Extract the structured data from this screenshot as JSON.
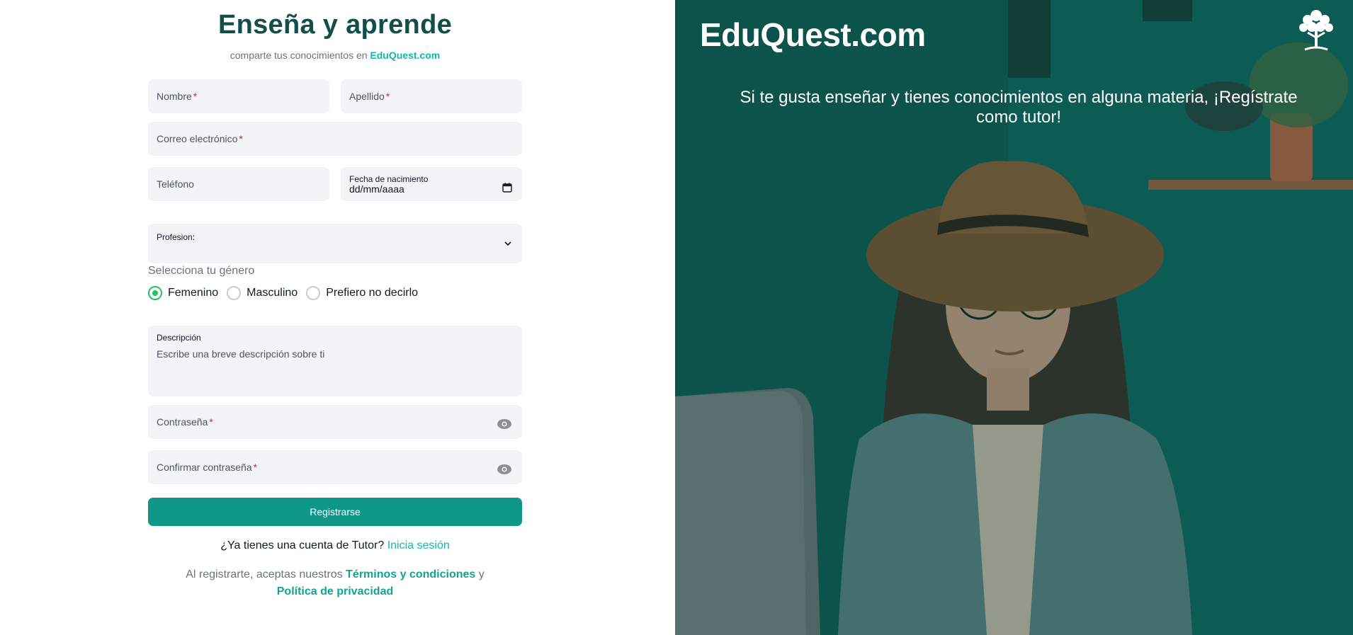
{
  "form": {
    "title": "Enseña y aprende",
    "subtitle_prefix": "comparte tus conocimientos en ",
    "subtitle_brand": "EduQuest.com",
    "required_mark": "*",
    "first_name_label": "Nombre",
    "last_name_label": "Apellido",
    "email_label": "Correo electrónico",
    "phone_label": "Teléfono",
    "birthdate_label": "Fecha de nacimiento",
    "birthdate_value": "dd/mm/aaaa",
    "profession_label": "Profesion:",
    "gender_label": "Selecciona tu género",
    "gender_options": [
      "Femenino",
      "Masculino",
      "Prefiero no decirlo"
    ],
    "gender_selected": "Femenino",
    "description_label": "Descripción",
    "description_placeholder": "Escribe una breve descripción sobre ti",
    "password_label": "Contraseña",
    "confirm_password_label": "Confirmar contraseña",
    "submit_label": "Registrarse",
    "login_prompt": "¿Ya tienes una cuenta de Tutor? ",
    "login_link": "Inicia sesión",
    "terms_prefix": "Al registrarte, aceptas nuestros ",
    "terms_link": "Términos y condiciones",
    "terms_and": " y",
    "privacy_link": "Política de privacidad"
  },
  "hero": {
    "logo": "EduQuest.com",
    "tagline": "Si te gusta enseñar y tienes conocimientos en alguna materia, ¡Regístrate como tutor!",
    "logo_icon": "tree-icon"
  },
  "colors": {
    "accent": "#14b8a6",
    "button": "#0f978a",
    "title": "#134e4a",
    "required": "#e11d48",
    "radio_selected": "#22c55e"
  }
}
